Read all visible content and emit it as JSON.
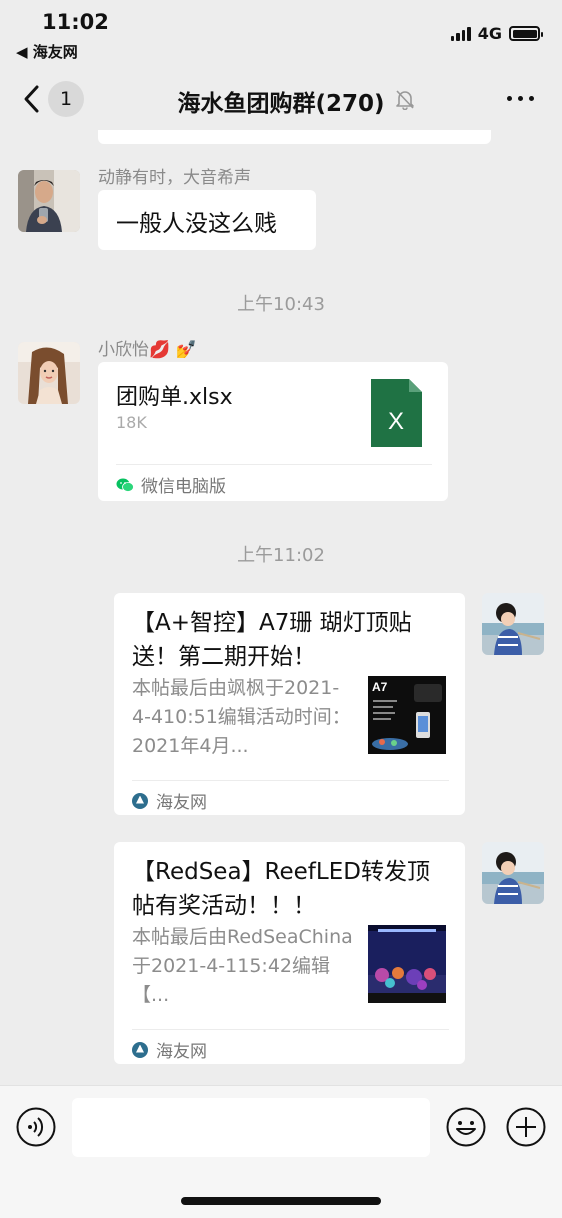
{
  "status_bar": {
    "time": "11:02",
    "back_app": "◀ 海友网",
    "network": "4G"
  },
  "nav": {
    "badge": "1",
    "title": "海水鱼团购群(270)"
  },
  "messages": {
    "msg1": {
      "sender": "动静有时，大音希声",
      "text": "一般人没这么贱"
    },
    "time1": "上午10:43",
    "msg2": {
      "sender": "小欣怡💋 💅",
      "file_name": "团购单.xlsx",
      "file_size": "18K",
      "file_source": "微信电脑版",
      "file_icon_letter": "X"
    },
    "time2": "上午11:02",
    "link1": {
      "title": "【A+智控】A7珊 瑚灯顶贴送！第二期开始！",
      "desc": "本帖最后由飒枫于2021-4-410:51编辑活动时间：2021年4月...",
      "thumb_label": "A7",
      "source": "海友网"
    },
    "link2": {
      "title": "【RedSea】ReefLED转发顶帖有奖活动！！！",
      "desc": "本帖最后由RedSeaChina于2021-4-115:42编辑【...",
      "source": "海友网"
    }
  },
  "colors": {
    "background": "#ededed",
    "bubble": "#ffffff",
    "excel_green": "#1f7244",
    "wechat_green": "#07c160"
  }
}
